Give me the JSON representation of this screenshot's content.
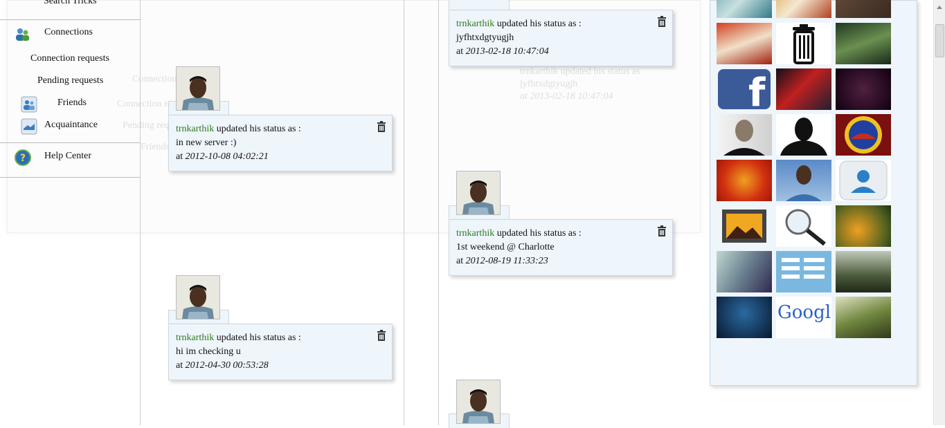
{
  "sidebar": {
    "search_tricks": "Search Tricks",
    "connections": "Connections",
    "connection_requests": "Connection requests",
    "pending_requests": "Pending requests",
    "friends": "Friends",
    "acquaintance": "Acquaintance",
    "help_center": "Help Center"
  },
  "posts_left": [
    {
      "user": "trnkarthik",
      "action": "updated his status as :",
      "status": "in new server :)",
      "at": "at",
      "timestamp": "2012-10-08 04:02:21"
    },
    {
      "user": "trnkarthik",
      "action": "updated his status as :",
      "status": "hi im checking u",
      "at": "at",
      "timestamp": "2012-04-30 00:53:28"
    }
  ],
  "posts_right": [
    {
      "user": "trnkarthik",
      "action": "updated his status as :",
      "status": "jyfhtxdgtyugjh",
      "at": "at",
      "timestamp": "2013-02-18 10:47:04"
    },
    {
      "user": "trnkarthik",
      "action": "updated his status as :",
      "status": "1st weekend @ Charlotte",
      "at": "at",
      "timestamp": "2012-08-19 11:33:23"
    }
  ],
  "ghost": {
    "connections": "Connections",
    "connection_requests": "Connection re",
    "pending_requests": "Pending requ",
    "friends": "Friends",
    "ghost_status_a": "trnkarthik updated his status as",
    "ghost_status_b": "jyfhtxdgtyugjh",
    "ghost_status_c": "at 2013-02-18 10:47:04"
  },
  "photos": {
    "google_text": "Google"
  }
}
